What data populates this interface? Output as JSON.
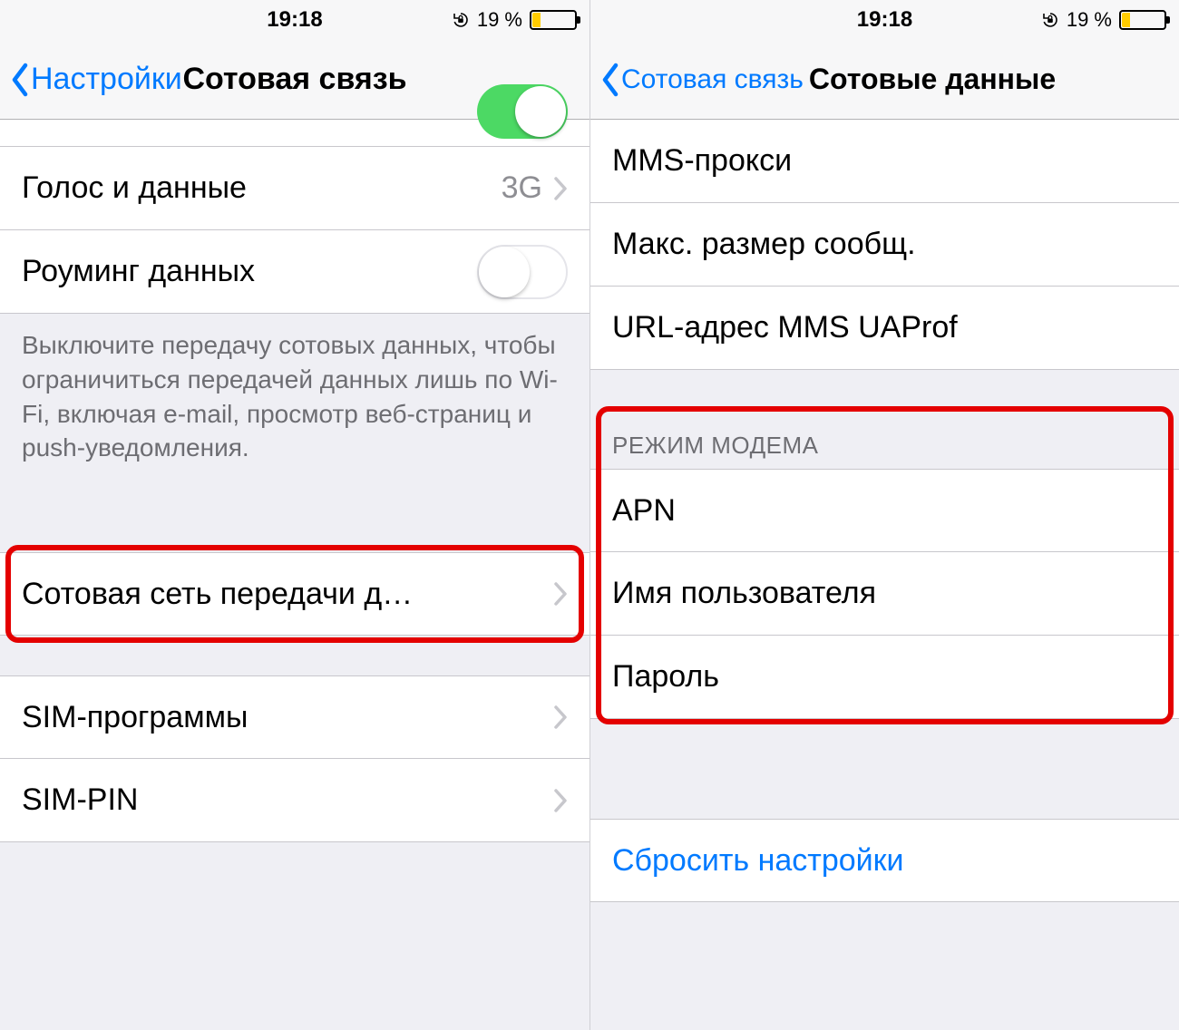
{
  "status": {
    "time": "19:18",
    "battery_pct": "19 %"
  },
  "left": {
    "nav_back": "Настройки",
    "nav_title": "Сотовая связь",
    "rows": {
      "voice_data": {
        "label": "Голос и данные",
        "value": "3G"
      },
      "roaming": {
        "label": "Роуминг данных"
      },
      "help": "Выключите передачу сотовых данных, чтобы ограничиться передачей данных лишь по Wi-Fi, включая e-mail, просмотр веб-страниц и push-уведомления.",
      "cell_network": {
        "label": "Сотовая сеть передачи д…"
      },
      "sim_apps": {
        "label": "SIM-программы"
      },
      "sim_pin": {
        "label": "SIM-PIN"
      }
    }
  },
  "right": {
    "nav_back": "Сотовая связь",
    "nav_title": "Сотовые данные",
    "rows": {
      "mms_proxy": "MMS-прокси",
      "max_msg": "Макс. размер сообщ.",
      "ua_prof": "URL-адрес MMS UAProf",
      "section_modem": "РЕЖИМ МОДЕМА",
      "apn": "APN",
      "user": "Имя пользователя",
      "pass": "Пароль",
      "reset": "Сбросить настройки"
    }
  }
}
